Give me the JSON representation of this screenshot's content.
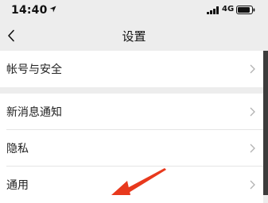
{
  "status": {
    "time": "14:40",
    "network": "4G"
  },
  "nav": {
    "title": "设置"
  },
  "groups": [
    {
      "items": [
        {
          "label": "帐号与安全"
        }
      ]
    },
    {
      "items": [
        {
          "label": "新消息通知"
        },
        {
          "label": "隐私"
        },
        {
          "label": "通用"
        }
      ]
    }
  ],
  "colors": {
    "background": "#ededed",
    "cell": "#ffffff",
    "annotation_arrow": "#e8391d",
    "chevron": "#b2b2b2"
  }
}
